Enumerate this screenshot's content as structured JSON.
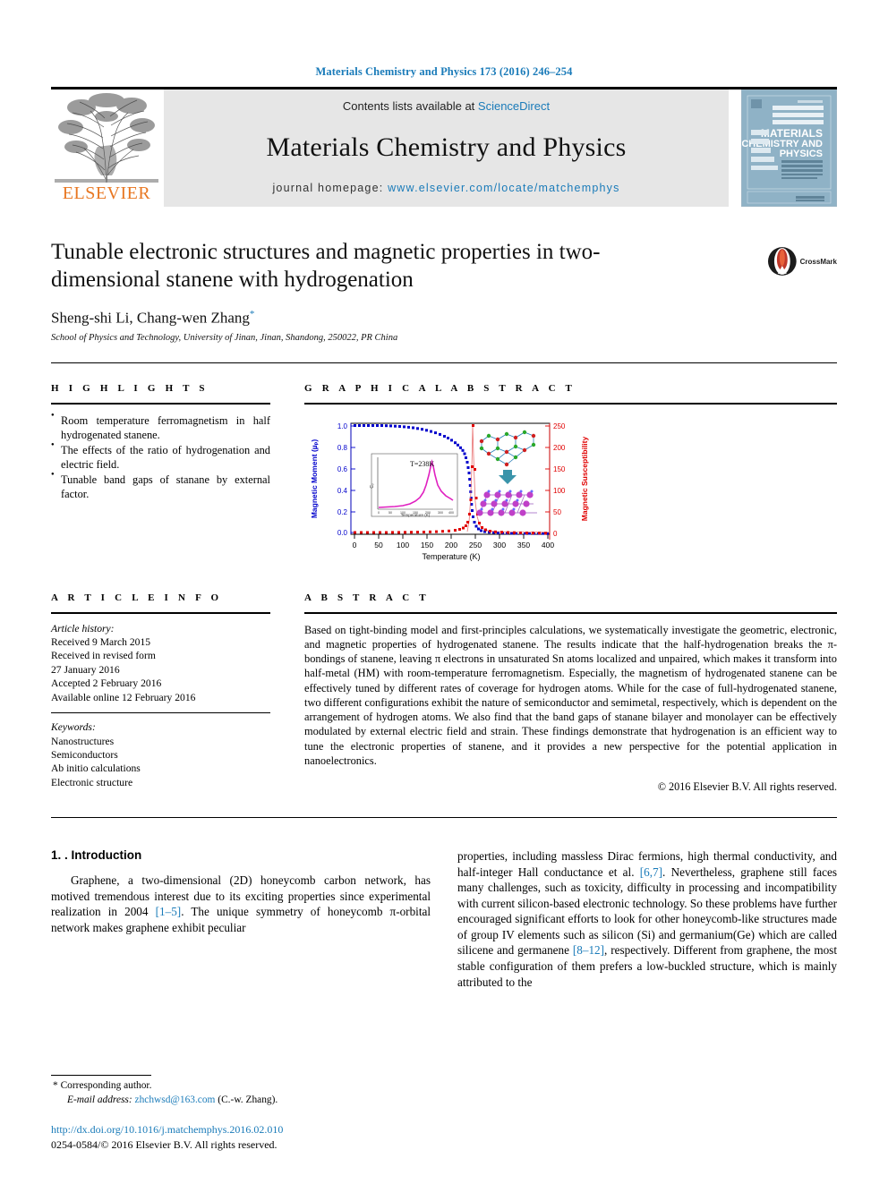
{
  "running_head": "Materials Chemistry and Physics 173 (2016) 246–254",
  "masthead": {
    "publisher_name": "ELSEVIER",
    "contents_prefix": "Contents lists available at ",
    "sciencedirect": "ScienceDirect",
    "journal_title": "Materials Chemistry and Physics",
    "homepage_prefix": "journal homepage: ",
    "homepage_url": "www.elsevier.com/locate/matchemphys",
    "cover_title_lines": [
      "MATERIALS",
      "CHEMISTRY AND",
      "PHYSICS"
    ],
    "accent_link_color": "#1a7bb9",
    "elsevier_orange": "#e87722"
  },
  "article": {
    "title": "Tunable electronic structures and magnetic properties in two-dimensional stanene with hydrogenation",
    "authors": "Sheng-shi Li, Chang-wen Zhang",
    "corresponding_marker": "*",
    "affiliation": "School of Physics and Technology, University of Jinan, Jinan, Shandong, 250022, PR China",
    "crossmark_label": "CrossMark"
  },
  "highlights": {
    "heading": "H I G H L I G H T S",
    "items": [
      "Room temperature ferromagnetism in half hydrogenated stanene.",
      "The effects of the ratio of hydrogenation and electric field.",
      "Tunable band gaps of stanane by external factor."
    ]
  },
  "graphical_abstract": {
    "heading": "G R A P H I C A L   A B S T R A C T"
  },
  "chart_data": {
    "type": "line",
    "title": "",
    "xlabel": "Temperature (K)",
    "ylabel_left": "Magnetic Moment (μB)",
    "ylabel_right": "Magnetic Susceptibility",
    "xlim": [
      0,
      400
    ],
    "ylim_left": [
      0.0,
      1.0
    ],
    "ylim_right": [
      0,
      250
    ],
    "xticks": [
      0,
      50,
      100,
      150,
      200,
      250,
      300,
      350,
      400
    ],
    "yticks_left": [
      "0.0",
      "0.2",
      "0.4",
      "0.6",
      "0.8",
      "1.0"
    ],
    "yticks_right": [
      "0",
      "50",
      "100",
      "150",
      "200",
      "250"
    ],
    "left_axis_color": "#0000cc",
    "right_axis_color": "#e00000",
    "grid": false,
    "legend": "none",
    "series": [
      {
        "name": "Magnetic Moment",
        "axis": "left",
        "color": "#0000cc",
        "marker": "square",
        "x": [
          0,
          20,
          40,
          60,
          80,
          100,
          120,
          140,
          160,
          180,
          195,
          205,
          215,
          222,
          228,
          232,
          234,
          236,
          238,
          240,
          243,
          247,
          252,
          260,
          270,
          285,
          300,
          320,
          340,
          360,
          380,
          400
        ],
        "y": [
          1.0,
          1.0,
          1.0,
          0.998,
          0.995,
          0.99,
          0.982,
          0.97,
          0.952,
          0.925,
          0.9,
          0.88,
          0.85,
          0.81,
          0.74,
          0.66,
          0.58,
          0.47,
          0.33,
          0.2,
          0.11,
          0.07,
          0.05,
          0.035,
          0.028,
          0.022,
          0.018,
          0.014,
          0.012,
          0.01,
          0.009,
          0.008
        ]
      },
      {
        "name": "Magnetic Susceptibility",
        "axis": "right",
        "color": "#e00000",
        "marker": "square",
        "x": [
          0,
          40,
          80,
          120,
          160,
          190,
          210,
          222,
          228,
          232,
          234,
          236,
          238,
          240,
          244,
          250,
          258,
          270,
          285,
          300,
          330,
          360,
          400
        ],
        "y": [
          1,
          1,
          1.5,
          2,
          3,
          5,
          9,
          17,
          30,
          55,
          105,
          180,
          245,
          150,
          78,
          40,
          22,
          13,
          9,
          7,
          5,
          4,
          3
        ]
      }
    ],
    "inset": {
      "type": "line",
      "annotation": "T=238K",
      "xlabel": "Temperature (K)",
      "ylabel": "Cᵥ",
      "color": "#e020c0",
      "peak_x": 238
    }
  },
  "article_info": {
    "heading": "A R T I C L E  I N F O",
    "history_label": "Article history:",
    "history": [
      "Received 9 March 2015",
      "Received in revised form",
      "27 January 2016",
      "Accepted 2 February 2016",
      "Available online 12 February 2016"
    ],
    "keywords_label": "Keywords:",
    "keywords": [
      "Nanostructures",
      "Semiconductors",
      "Ab initio calculations",
      "Electronic structure"
    ]
  },
  "abstract": {
    "heading": "A B S T R A C T",
    "text": "Based on tight-binding model and first-principles calculations, we systematically investigate the geometric, electronic, and magnetic properties of hydrogenated stanene. The results indicate that the half-hydrogenation breaks the π-bondings of stanene, leaving π electrons in unsaturated Sn atoms localized and unpaired, which makes it transform into half-metal (HM) with room-temperature ferromagnetism. Especially, the magnetism of hydrogenated stanene can be effectively tuned by different rates of coverage for hydrogen atoms. While for the case of full-hydrogenated stanene, two different configurations exhibit the nature of semiconductor and semimetal, respectively, which is dependent on the arrangement of hydrogen atoms. We also find that the band gaps of stanane bilayer and monolayer can be effectively modulated by external electric field and strain. These findings demonstrate that hydrogenation is an efficient way to tune the electronic properties of stanene, and it provides a new perspective for the potential application in nanoelectronics.",
    "copyright": "© 2016 Elsevier B.V. All rights reserved."
  },
  "introduction": {
    "heading": "1. . Introduction",
    "left_paragraph_lead": "Graphene, a two-dimensional (2D) honeycomb carbon network, has motived tremendous interest due to its exciting properties since experimental realization in 2004 ",
    "ref_1_5": "[1–5]",
    "left_paragraph_rest": ". The unique symmetry of honeycomb π-orbital network makes graphene exhibit peculiar",
    "right_part_1": "properties, including massless Dirac fermions, high thermal conductivity, and half-integer Hall conductance et al. ",
    "ref_6_7": "[6,7]",
    "right_part_2": ". Nevertheless, graphene still faces many challenges, such as toxicity, difficulty in processing and incompatibility with current silicon-based electronic technology. So these problems have further encouraged significant efforts to look for other honeycomb-like structures made of group IV elements such as silicon (Si) and germanium(Ge) which are called silicene and germanene ",
    "ref_8_12": "[8–12]",
    "right_part_3": ", respectively. Different from graphene, the most stable configuration of them prefers a low-buckled structure, which is mainly attributed to the"
  },
  "footer": {
    "corresponding_marker": "*",
    "corresponding_label": "Corresponding author.",
    "email_label": "E-mail address:",
    "email": "zhchwsd@163.com",
    "email_suffix": "(C.-w. Zhang).",
    "doi": "http://dx.doi.org/10.1016/j.matchemphys.2016.02.010",
    "issn_line": "0254-0584/© 2016 Elsevier B.V. All rights reserved."
  }
}
